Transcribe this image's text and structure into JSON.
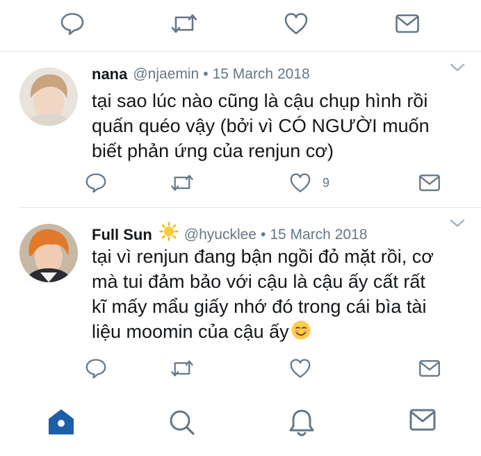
{
  "top_actions": {
    "reply_icon": "reply-icon",
    "retweet_icon": "retweet-icon",
    "like_icon": "like-icon",
    "dm_icon": "mail-icon"
  },
  "tweets": [
    {
      "name": "nana",
      "handle": "@njaemin",
      "separator": "•",
      "date": "15 March 2018",
      "text_lines": [
        "tại sao lúc nào cũng là cậu chụp hình rồi",
        "quấn quéo vậy (bởi vì CÓ NGƯỜI muốn",
        "biết phản ứng của renjun cơ)"
      ],
      "like_count": "9"
    },
    {
      "name": "Full Sun",
      "name_emoji": "sun-emoji",
      "handle": "@hyucklee",
      "separator": "•",
      "date": "15 March 2018",
      "text_lines": [
        "tại vì renjun đang bận ngồi đỏ mặt rồi, cơ",
        "mà tui đảm bảo với cậu là cậu ấy cất rất",
        "kĩ mấy mẩu giấy nhớ đó trong cái bìa tài",
        "liệu moomin của cậu ấy"
      ],
      "text_emoji": "smiling-face-emoji",
      "like_count": ""
    }
  ],
  "colors": {
    "icon_gray": "#657786",
    "text": "#14171a",
    "divider": "#e1e8ed",
    "nav_active": "#1d5fa8"
  },
  "bottom_nav": [
    "home",
    "search",
    "notifications",
    "messages"
  ]
}
